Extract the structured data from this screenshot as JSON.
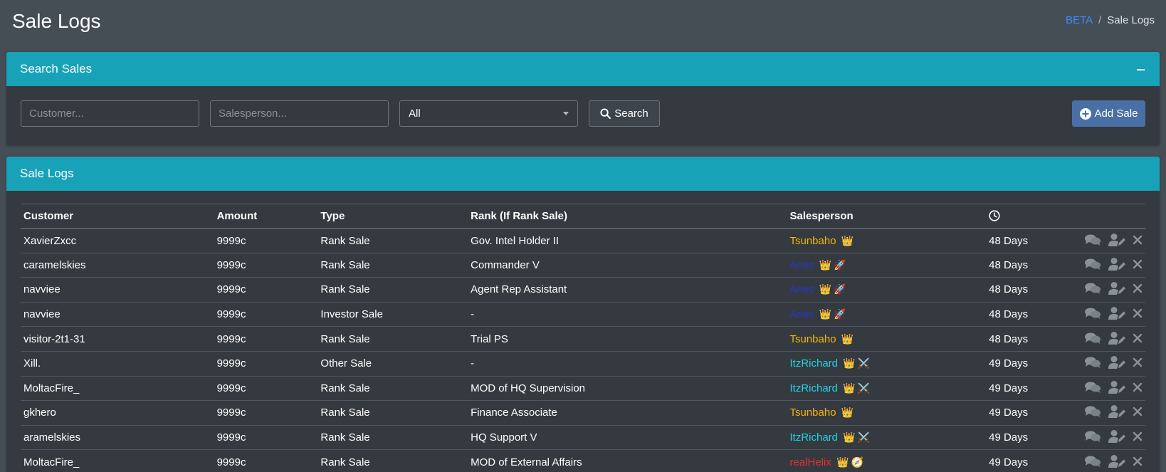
{
  "page": {
    "title": "Sale Logs",
    "breadcrumb": {
      "link": "BETA",
      "separator": "/",
      "current": "Sale Logs"
    }
  },
  "search_card": {
    "title": "Search Sales",
    "customer_placeholder": "Customer...",
    "salesperson_placeholder": "Salesperson...",
    "type_selected": "All",
    "search_label": "Search",
    "add_label": "Add Sale"
  },
  "logs_card": {
    "title": "Sale Logs",
    "columns": [
      "Customer",
      "Amount",
      "Type",
      "Rank (If Rank Sale)",
      "Salesperson"
    ],
    "time_column_icon": "clock-icon",
    "rows": [
      {
        "customer": "XavierZxcc",
        "amount": "9999c",
        "type": "Rank Sale",
        "rank": "Gov. Intel Holder II",
        "salesperson": "Tsunbaho",
        "color": "#f5b400",
        "badges": [
          "👑"
        ],
        "time": "48 Days"
      },
      {
        "customer": "caramelskies",
        "amount": "9999c",
        "type": "Rank Sale",
        "rank": "Commander V",
        "salesperson": "Aries",
        "color": "#2a34c9",
        "badges": [
          "👑",
          "🚀"
        ],
        "time": "48 Days"
      },
      {
        "customer": "navviee",
        "amount": "9999c",
        "type": "Rank Sale",
        "rank": "Agent Rep Assistant",
        "salesperson": "Aries",
        "color": "#2a34c9",
        "badges": [
          "👑",
          "🚀"
        ],
        "time": "48 Days"
      },
      {
        "customer": "navviee",
        "amount": "9999c",
        "type": "Investor Sale",
        "rank": "-",
        "salesperson": "Aries",
        "color": "#2a34c9",
        "badges": [
          "👑",
          "🚀"
        ],
        "time": "48 Days"
      },
      {
        "customer": "visitor-2t1-31",
        "amount": "9999c",
        "type": "Rank Sale",
        "rank": "Trial PS",
        "salesperson": "Tsunbaho",
        "color": "#f5b400",
        "badges": [
          "👑"
        ],
        "time": "48 Days"
      },
      {
        "customer": "Xill.",
        "amount": "9999c",
        "type": "Other Sale",
        "rank": "-",
        "salesperson": "ItzRichard",
        "color": "#22d3e6",
        "badges": [
          "👑",
          "⚔️"
        ],
        "time": "49 Days"
      },
      {
        "customer": "MoltacFire_",
        "amount": "9999c",
        "type": "Rank Sale",
        "rank": "MOD of HQ Supervision",
        "salesperson": "ItzRichard",
        "color": "#22d3e6",
        "badges": [
          "👑",
          "⚔️"
        ],
        "time": "49 Days"
      },
      {
        "customer": "gkhero",
        "amount": "9999c",
        "type": "Rank Sale",
        "rank": "Finance Associate",
        "salesperson": "Tsunbaho",
        "color": "#f5b400",
        "badges": [
          "👑"
        ],
        "time": "49 Days"
      },
      {
        "customer": "aramelskies",
        "amount": "9999c",
        "type": "Rank Sale",
        "rank": "HQ Support V",
        "salesperson": "ItzRichard",
        "color": "#22d3e6",
        "badges": [
          "👑",
          "⚔️"
        ],
        "time": "49 Days"
      },
      {
        "customer": "MoltacFire_",
        "amount": "9999c",
        "type": "Rank Sale",
        "rank": "MOD of External Affairs",
        "salesperson": "realHelix",
        "color": "#e03131",
        "badges": [
          "👑",
          "🧭"
        ],
        "time": "49 Days"
      }
    ]
  },
  "colors": {
    "background": "#454d55",
    "card": "#343a40",
    "card_header": "#17a2b8",
    "add_button": "#4a6fa5",
    "breadcrumb_link": "#3f8cff"
  },
  "icons": {
    "search": "search-icon",
    "add": "plus-circle-icon",
    "collapse": "minus-icon",
    "row_actions": [
      "comments-icon",
      "user-edit-icon",
      "close-icon"
    ]
  }
}
